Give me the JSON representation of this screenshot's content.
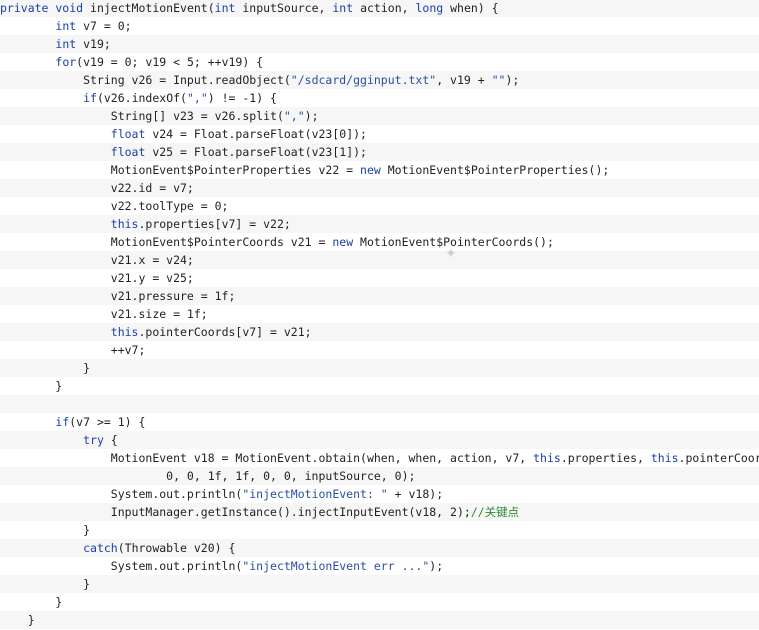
{
  "code_lines": [
    [
      {
        "t": "private void",
        "c": "kw"
      },
      {
        "t": " injectMotionEvent(",
        "c": ""
      },
      {
        "t": "int",
        "c": "kw"
      },
      {
        "t": " inputSource, ",
        "c": ""
      },
      {
        "t": "int",
        "c": "kw"
      },
      {
        "t": " action, ",
        "c": ""
      },
      {
        "t": "long",
        "c": "kw"
      },
      {
        "t": " when) {",
        "c": ""
      }
    ],
    [
      {
        "t": "        ",
        "c": ""
      },
      {
        "t": "int",
        "c": "kw"
      },
      {
        "t": " v7 = 0;",
        "c": ""
      }
    ],
    [
      {
        "t": "        ",
        "c": ""
      },
      {
        "t": "int",
        "c": "kw"
      },
      {
        "t": " v19;",
        "c": ""
      }
    ],
    [
      {
        "t": "        ",
        "c": ""
      },
      {
        "t": "for",
        "c": "kw"
      },
      {
        "t": "(v19 = 0; v19 < 5; ++v19) {",
        "c": ""
      }
    ],
    [
      {
        "t": "            String v26 = Input.readObject(",
        "c": ""
      },
      {
        "t": "\"/sdcard/gginput.txt\"",
        "c": "str"
      },
      {
        "t": ", v19 + ",
        "c": ""
      },
      {
        "t": "\"\"",
        "c": "str"
      },
      {
        "t": ");",
        "c": ""
      }
    ],
    [
      {
        "t": "            ",
        "c": ""
      },
      {
        "t": "if",
        "c": "kw"
      },
      {
        "t": "(v26.indexOf(",
        "c": ""
      },
      {
        "t": "\",\"",
        "c": "str"
      },
      {
        "t": ") != -1) {",
        "c": ""
      }
    ],
    [
      {
        "t": "                String[] v23 = v26.split(",
        "c": ""
      },
      {
        "t": "\",\"",
        "c": "str"
      },
      {
        "t": ");",
        "c": ""
      }
    ],
    [
      {
        "t": "                ",
        "c": ""
      },
      {
        "t": "float",
        "c": "kw"
      },
      {
        "t": " v24 = Float.parseFloat(v23[0]);",
        "c": ""
      }
    ],
    [
      {
        "t": "                ",
        "c": ""
      },
      {
        "t": "float",
        "c": "kw"
      },
      {
        "t": " v25 = Float.parseFloat(v23[1]);",
        "c": ""
      }
    ],
    [
      {
        "t": "                MotionEvent$PointerProperties v22 = ",
        "c": ""
      },
      {
        "t": "new",
        "c": "kw"
      },
      {
        "t": " MotionEvent$PointerProperties();",
        "c": ""
      }
    ],
    [
      {
        "t": "                v22.id = v7;",
        "c": ""
      }
    ],
    [
      {
        "t": "                v22.toolType = 0;",
        "c": ""
      }
    ],
    [
      {
        "t": "                ",
        "c": ""
      },
      {
        "t": "this",
        "c": "kw"
      },
      {
        "t": ".properties[v7] = v22;",
        "c": ""
      }
    ],
    [
      {
        "t": "                MotionEvent$PointerCoords v21 = ",
        "c": ""
      },
      {
        "t": "new",
        "c": "kw"
      },
      {
        "t": " MotionEvent$PointerCoords();",
        "c": ""
      }
    ],
    [
      {
        "t": "                v21.x = v24;",
        "c": ""
      }
    ],
    [
      {
        "t": "                v21.y = v25;",
        "c": ""
      }
    ],
    [
      {
        "t": "                v21.pressure = 1f;",
        "c": ""
      }
    ],
    [
      {
        "t": "                v21.size = 1f;",
        "c": ""
      }
    ],
    [
      {
        "t": "                ",
        "c": ""
      },
      {
        "t": "this",
        "c": "kw"
      },
      {
        "t": ".pointerCoords[v7] = v21;",
        "c": ""
      }
    ],
    [
      {
        "t": "                ++v7;",
        "c": ""
      }
    ],
    [
      {
        "t": "            }",
        "c": ""
      }
    ],
    [
      {
        "t": "        }",
        "c": ""
      }
    ],
    [
      {
        "t": "",
        "c": ""
      }
    ],
    [
      {
        "t": "        ",
        "c": ""
      },
      {
        "t": "if",
        "c": "kw"
      },
      {
        "t": "(v7 >= 1) {",
        "c": ""
      }
    ],
    [
      {
        "t": "            ",
        "c": ""
      },
      {
        "t": "try",
        "c": "kw"
      },
      {
        "t": " {",
        "c": ""
      }
    ],
    [
      {
        "t": "                MotionEvent v18 = MotionEvent.obtain(when, when, action, v7, ",
        "c": ""
      },
      {
        "t": "this",
        "c": "kw"
      },
      {
        "t": ".properties, ",
        "c": ""
      },
      {
        "t": "this",
        "c": "kw"
      },
      {
        "t": ".pointerCoords,",
        "c": ""
      }
    ],
    [
      {
        "t": "                        0, 0, 1f, 1f, 0, 0, inputSource, 0);",
        "c": ""
      }
    ],
    [
      {
        "t": "                System.out.println(",
        "c": ""
      },
      {
        "t": "\"injectMotionEvent: \"",
        "c": "str"
      },
      {
        "t": " + v18);",
        "c": ""
      }
    ],
    [
      {
        "t": "                InputManager.getInstance().injectInputEvent(v18, 2);",
        "c": ""
      },
      {
        "t": "//关键点",
        "c": "cmt"
      }
    ],
    [
      {
        "t": "            }",
        "c": ""
      }
    ],
    [
      {
        "t": "            ",
        "c": ""
      },
      {
        "t": "catch",
        "c": "kw"
      },
      {
        "t": "(Throwable v20) {",
        "c": ""
      }
    ],
    [
      {
        "t": "                System.out.println(",
        "c": ""
      },
      {
        "t": "\"injectMotionEvent err ...\"",
        "c": "str"
      },
      {
        "t": ");",
        "c": ""
      }
    ],
    [
      {
        "t": "            }",
        "c": ""
      }
    ],
    [
      {
        "t": "        }",
        "c": ""
      }
    ],
    [
      {
        "t": "    }",
        "c": ""
      }
    ]
  ],
  "colors": {
    "keyword": "#1a3fa6",
    "string": "#2a4ea1",
    "comment": "#2e8b2e",
    "stripe": "#f6f6f6"
  },
  "icons": {
    "cursor": "busy-cursor-icon"
  }
}
